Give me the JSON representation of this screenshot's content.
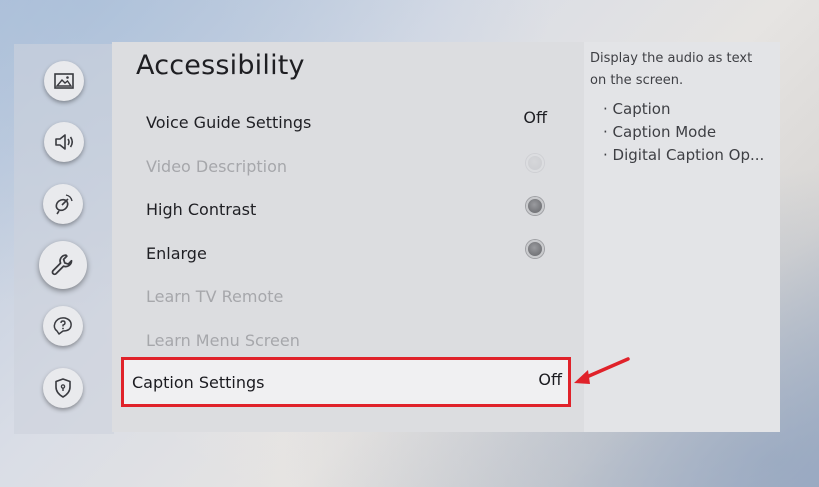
{
  "title": "Accessibility",
  "sidebar": {
    "items": [
      {
        "icon": "picture-icon"
      },
      {
        "icon": "sound-icon"
      },
      {
        "icon": "broadcast-icon"
      },
      {
        "icon": "wrench-icon",
        "active": true
      },
      {
        "icon": "support-icon"
      },
      {
        "icon": "shield-icon"
      }
    ]
  },
  "menu": {
    "voice_guide": {
      "label": "Voice Guide Settings",
      "value": "Off"
    },
    "video_description": {
      "label": "Video Description"
    },
    "high_contrast": {
      "label": "High Contrast"
    },
    "enlarge": {
      "label": "Enlarge"
    },
    "learn_tv_remote": {
      "label": "Learn TV Remote"
    },
    "learn_menu_screen": {
      "label": "Learn Menu Screen"
    },
    "caption_settings": {
      "label": "Caption Settings",
      "value": "Off"
    }
  },
  "info": {
    "description": "Display the audio as text on the screen.",
    "bullets": [
      "· Caption",
      "· Caption Mode",
      "· Digital Caption Op..."
    ]
  },
  "colors": {
    "highlight_border": "#e0222a",
    "arrow": "#e0222a"
  }
}
